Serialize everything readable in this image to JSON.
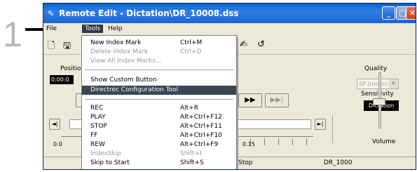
{
  "step_number": "1",
  "window": {
    "title": "Remote Edit - Dictation\\DR_10008.dss",
    "title_icon": "pen-icon"
  },
  "menubar": {
    "file": "File",
    "tools": "Tools",
    "help": "Help"
  },
  "controls": {
    "position_label": "Positio",
    "position_value": "0:00:0",
    "quality_label": "Quality",
    "quality_value": "SP (mono)",
    "sensitivity_label": "Sensitivity",
    "sensitivity_value": "Dictation",
    "volume_label": "Volume",
    "timeline_start": "0.0",
    "timeline_mark": "0.15",
    "ff_label": "▶▶",
    "end_label": "▶▶|",
    "prev_index": "◄|",
    "next_index": "►|"
  },
  "statusbar": {
    "state": "Stop",
    "file": "DR_1000"
  },
  "tools_menu": {
    "items": [
      {
        "label": "New Index Mark",
        "shortcut": "Ctrl+M",
        "disabled": false
      },
      {
        "label": "Delete Index Mark",
        "shortcut": "Ctrl+D",
        "disabled": true
      },
      {
        "label": "View All Index Marks...",
        "shortcut": "",
        "disabled": true
      },
      {
        "label": "Show Custom Button",
        "shortcut": "",
        "disabled": false
      },
      {
        "label": "Directrec Configuration Tool",
        "shortcut": "",
        "disabled": false,
        "selected": true
      },
      {
        "label": "REC",
        "shortcut": "Alt+R",
        "disabled": false
      },
      {
        "label": "PLAY",
        "shortcut": "Alt+Ctrl+F12",
        "disabled": false
      },
      {
        "label": "STOP",
        "shortcut": "Alt+Ctrl+F11",
        "disabled": false
      },
      {
        "label": "FF",
        "shortcut": "Alt+Ctrl+F10",
        "disabled": false
      },
      {
        "label": "REW",
        "shortcut": "Alt+Ctrl+F9",
        "disabled": false
      },
      {
        "label": "IndexSkip",
        "shortcut": "Shift+I",
        "disabled": true
      },
      {
        "label": "Skip to Start",
        "shortcut": "Shift+S",
        "disabled": false
      }
    ]
  },
  "colors": {
    "titlebar": "#1c64d2",
    "menu_highlight": "#3a4654",
    "step_number": "#b8b8b8"
  }
}
